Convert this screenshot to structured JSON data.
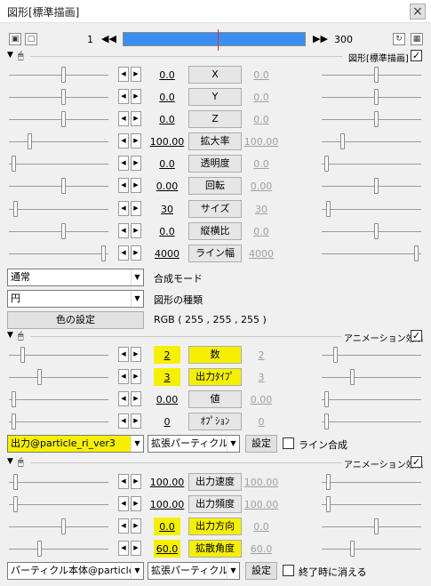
{
  "window": {
    "title": "図形[標準描画]",
    "close_label": "×"
  },
  "timeline": {
    "start_frame": "1",
    "end_frame": "300",
    "prev_label": "◀◀",
    "next_label": "▶▶",
    "position_fraction": 0.52
  },
  "sections": {
    "main": {
      "title": "図形[標準描画]",
      "checked": true,
      "params": [
        {
          "label": "X",
          "value": "0.0",
          "value2": "0.0",
          "pos1": 0.55,
          "pos2": 0.55
        },
        {
          "label": "Y",
          "value": "0.0",
          "value2": "0.0",
          "pos1": 0.55,
          "pos2": 0.55
        },
        {
          "label": "Z",
          "value": "0.0",
          "value2": "0.0",
          "pos1": 0.55,
          "pos2": 0.55
        },
        {
          "label": "拡大率",
          "value": "100.00",
          "value2": "100.00",
          "pos1": 0.2,
          "pos2": 0.2
        },
        {
          "label": "透明度",
          "value": "0.0",
          "value2": "0.0",
          "pos1": 0.03,
          "pos2": 0.03
        },
        {
          "label": "回転",
          "value": "0.00",
          "value2": "0.00",
          "pos1": 0.55,
          "pos2": 0.55
        },
        {
          "label": "サイズ",
          "value": "30",
          "value2": "30",
          "pos1": 0.05,
          "pos2": 0.05
        },
        {
          "label": "縦横比",
          "value": "0.0",
          "value2": "0.0",
          "pos1": 0.55,
          "pos2": 0.55
        },
        {
          "label": "ライン幅",
          "value": "4000",
          "value2": "4000",
          "pos1": 0.97,
          "pos2": 0.97
        }
      ],
      "blend_select": "通常",
      "blend_label": "合成モード",
      "shape_select": "円",
      "shape_label": "図形の種類",
      "color_button": "色の設定",
      "rgb_text": "RGB ( 255 , 255 , 255 )"
    },
    "anim1": {
      "title": "アニメーション効果",
      "checked": true,
      "params": [
        {
          "label": "数",
          "value": "2",
          "value2": "2",
          "pos1": 0.12,
          "pos2": 0.12,
          "highlight": true
        },
        {
          "label": "出力ﾀｲﾌﾟ",
          "value": "3",
          "value2": "3",
          "pos1": 0.3,
          "pos2": 0.3,
          "highlight": true
        },
        {
          "label": "値",
          "value": "0.00",
          "value2": "0.00",
          "pos1": 0.03,
          "pos2": 0.03,
          "highlight": false
        },
        {
          "label": "ｵﾌﾟｼｮﾝ",
          "value": "0",
          "value2": "0",
          "pos1": 0.03,
          "pos2": 0.03,
          "highlight": false
        }
      ],
      "script_select": "出力@particle_ri_ver3",
      "type_select": "拡張パーティクル(",
      "settings_button": "設定",
      "checkbox_label": "ライン合成"
    },
    "anim2": {
      "title": "アニメーション効果",
      "checked": true,
      "params": [
        {
          "label": "出力速度",
          "value": "100.00",
          "value2": "100.00",
          "pos1": 0.05,
          "pos2": 0.05,
          "highlight": false
        },
        {
          "label": "出力頻度",
          "value": "100.00",
          "value2": "100.00",
          "pos1": 0.05,
          "pos2": 0.05,
          "highlight": false
        },
        {
          "label": "出力方向",
          "value": "0.0",
          "value2": "0.0",
          "pos1": 0.55,
          "pos2": 0.55,
          "highlight": true
        },
        {
          "label": "拡散角度",
          "value": "60.0",
          "value2": "60.0",
          "pos1": 0.3,
          "pos2": 0.3,
          "highlight": true
        }
      ],
      "script_select": "パーティクル本体@particle_",
      "type_select": "拡張パーティクル(",
      "settings_button": "設定",
      "checkbox_label": "終了時に消える"
    }
  },
  "icons": {
    "expand": "▼",
    "mouse": "mouse-icon",
    "check": "✓",
    "left_arrow": "◀",
    "right_arrow": "▶",
    "dropdown": "▼"
  },
  "colors": {
    "timeline": "#3b8ff0",
    "highlight": "#f5f000",
    "cursor": "#e03030"
  }
}
